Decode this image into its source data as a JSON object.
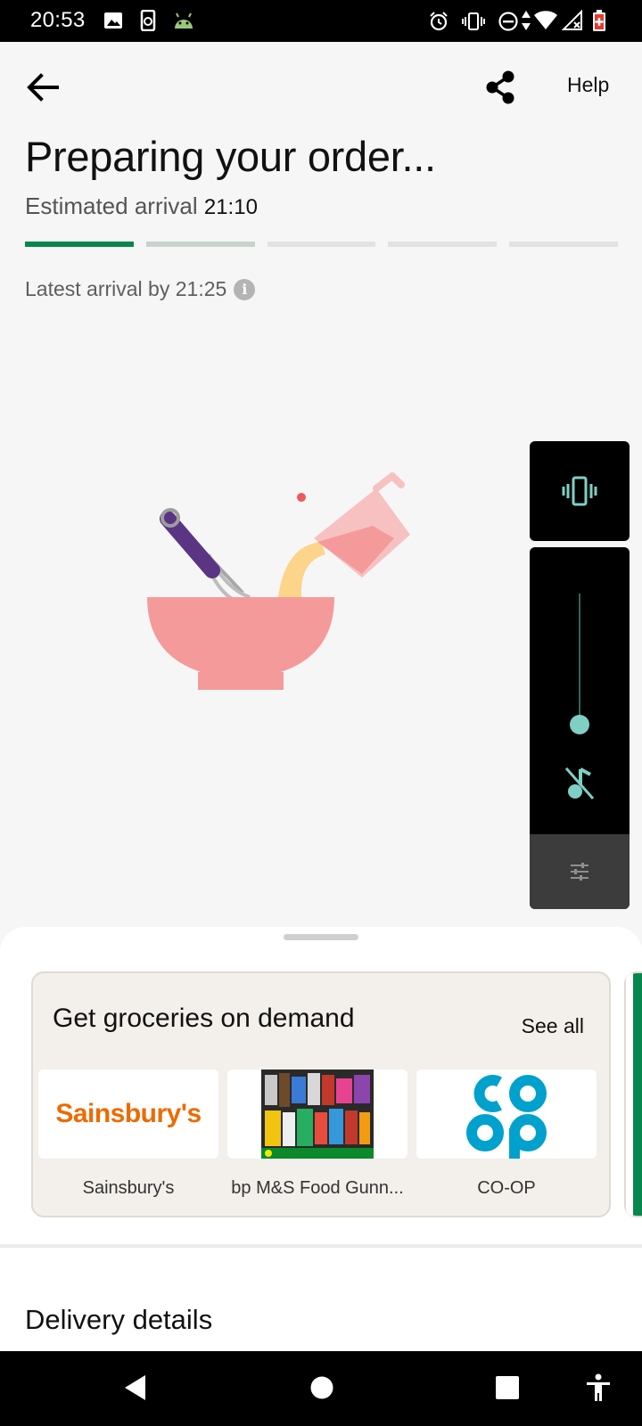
{
  "status_bar": {
    "time": "20:53",
    "left_icons": [
      "image-icon",
      "phone-sync-icon",
      "android-icon"
    ],
    "right_icons": [
      "alarm-icon",
      "vibrate-icon",
      "do-not-disturb-icon",
      "data-arrows-icon",
      "wifi-icon",
      "signal-icon",
      "battery-low-icon"
    ]
  },
  "header": {
    "back_icon": "arrow-left-icon",
    "share_icon": "share-icon",
    "help_label": "Help"
  },
  "order": {
    "title": "Preparing your order...",
    "eta_label": "Estimated arrival",
    "eta_time": "21:10",
    "progress_segments": [
      "active",
      "partial",
      "inactive",
      "inactive",
      "inactive"
    ],
    "latest_arrival": "Latest arrival by 21:25",
    "info_icon": "info-icon"
  },
  "volume_panel": {
    "vibrate_icon": "vibrate-icon",
    "mute_icon": "music-off-icon",
    "settings_icon": "sliders-icon",
    "level": 0
  },
  "groceries": {
    "title": "Get groceries on demand",
    "see_all_label": "See all",
    "stores": [
      {
        "name": "Sainsbury's",
        "logo_text": "Sainsbury's"
      },
      {
        "name": "bp M&S Food Gunn..."
      },
      {
        "name": "CO-OP",
        "logo_text": "co op"
      }
    ]
  },
  "delivery": {
    "title": "Delivery details"
  },
  "nav_bar": {
    "buttons": [
      "back-triangle-icon",
      "home-circle-icon",
      "recents-square-icon",
      "accessibility-icon"
    ]
  },
  "colors": {
    "accent_green": "#06874e",
    "sainsburys_orange": "#ec6b00",
    "coop_blue": "#00a1cc",
    "bowl_pink": "#f59a9a",
    "whisk_purple": "#5a3584",
    "volume_teal": "#7fcfc4"
  }
}
